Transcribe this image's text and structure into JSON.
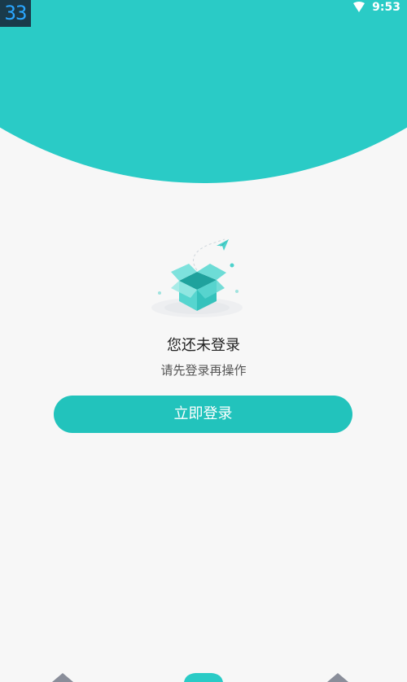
{
  "status_bar": {
    "badge": "33",
    "time": "9:53",
    "signal_icon": "signal-icon"
  },
  "empty_state": {
    "illustration_icon": "open-box-icon",
    "title": "您还未登录",
    "subtitle": "请先登录再操作"
  },
  "actions": {
    "login_label": "立即登录"
  },
  "colors": {
    "accent": "#2acbc6",
    "button": "#22c3bc",
    "background": "#f7f7f7"
  },
  "bottom_nav": {
    "icons": [
      "nav-left-icon",
      "nav-center-icon",
      "nav-right-icon"
    ]
  }
}
